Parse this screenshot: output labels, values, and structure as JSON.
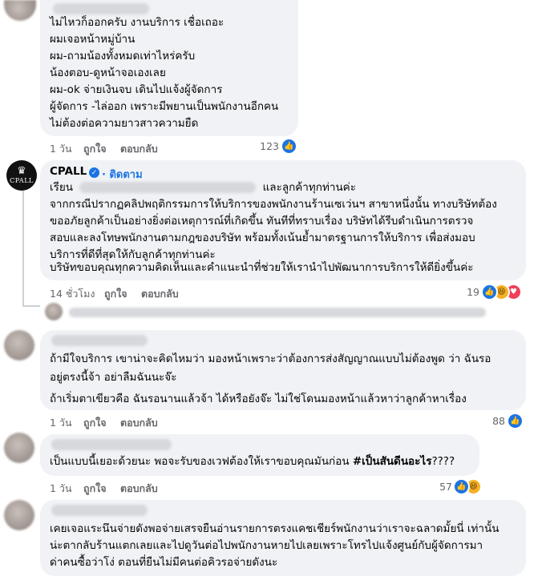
{
  "comments": [
    {
      "lines": [
        "ไม่ไหวก็ออกครับ งานบริการ เชื่อเถอะ",
        "ผมเจอหน้าหมู่บ้าน",
        "ผม-ถามน้องทั้งหมดเท่าไหร่ครับ",
        "น้องตอบ-ดูหน้าจอเองเลย",
        "ผม-ok จ่ายเงินจบ เดินไปแจ้งผู้จัดการ",
        "ผู้จัดการ -ไล่ออก เพราะมีพยานเป็นพนักงานอีกคน",
        "ไม่ต้องต่อความยาวสาวความยืด"
      ],
      "time": "1 วัน",
      "like": "ถูกใจ",
      "reply": "ตอบกลับ",
      "count": "123",
      "reactions": [
        "like"
      ]
    },
    {
      "author": "CPALL",
      "follow": "· ติดตาม",
      "avatar_logo": "CPALL",
      "line1_start": "เรียน",
      "line1_end": "และลูกค้าทุกท่านค่ะ",
      "lines": [
        "จากกรณีปรากฏคลิปพฤติกรรมการให้บริการของพนักงานร้านเซเว่นฯ สาขาหนึ่งนั้น ทางบริษัทต้อง",
        "ขออภัยลูกค้าเป็นอย่างยิ่งต่อเหตุการณ์ที่เกิดขึ้น ทันทีที่ทราบเรื่อง บริษัทได้รีบดำเนินการตรวจ",
        "สอบและลงโทษพนักงานตามกฎของบริษัท พร้อมทั้งเน้นย้ำมาตรฐานการให้บริการ เพื่อส่งมอบ",
        "บริการที่ดีที่สุดให้กับลูกค้าทุกท่านค่ะ",
        "บริษัทขอบคุณทุกความคิดเห็นและคำแนะนำที่ช่วยให้เรานำไปพัฒนาการบริการให้ดียิ่งขึ้นค่ะ"
      ],
      "time": "14 ชั่วโมง",
      "like": "ถูกใจ",
      "reply": "ตอบกลับ",
      "count": "19",
      "reactions": [
        "like",
        "haha",
        "love"
      ]
    },
    {
      "lines": [
        "ถ้ามีใจบริการ เขาน่าจะคิดไหมว่า มองหน้าเพราะว่าต้องการส่งสัญญาณแบบไม่ต้องพูด ว่า ฉันรอ",
        "อยู่ตรงนี้จ้า อย่าลืมฉันนะจ๊ะ",
        "ถ้าเริ่มตาเขียวคือ ฉันรอนานแล้วจ้า ได้หรือยังจ๊ะ ไม่ใช่โดนมองหน้าแล้วหาว่าลูกค้าหาเรื่อง"
      ],
      "time": "1 วัน",
      "like": "ถูกใจ",
      "reply": "ตอบกลับ",
      "count": "88",
      "reactions": [
        "like"
      ]
    },
    {
      "line_start": "เป็นแบบนี้เยอะด้วยนะ พอจะรับของเวฟต้องให้เราขอบคุณมันก่อน ",
      "line_bold": "#เป็นสันดีนอะไร",
      "line_end": "????",
      "time": "1 วัน",
      "like": "ถูกใจ",
      "reply": "ตอบกลับ",
      "count": "57",
      "reactions": [
        "like",
        "haha"
      ]
    },
    {
      "lines": [
        "เคยเจอแระนึนจ่ายดังพอจ่ายเสรจยืนอ่านรายการตรงแคชเชียร์พนักงานว่าเราจะฉลาดมั้ยนี่ เท่านั้น",
        "น่ะตากลับร้านแตกเลยและไปดูวันต่อไปพนักงานหายไปเลยเพราะโทรไปแจ้งศูนย์กับผู้จัดการมา",
        "ด่าคนซื้อว่าโง่ ตอนที่ยืนไม่มีคนต่อคิวรอจ่ายดังนะ"
      ]
    }
  ],
  "colors": {
    "accent": "#1b74e4",
    "bubble": "#f0f2f5",
    "meta": "#65676b"
  }
}
